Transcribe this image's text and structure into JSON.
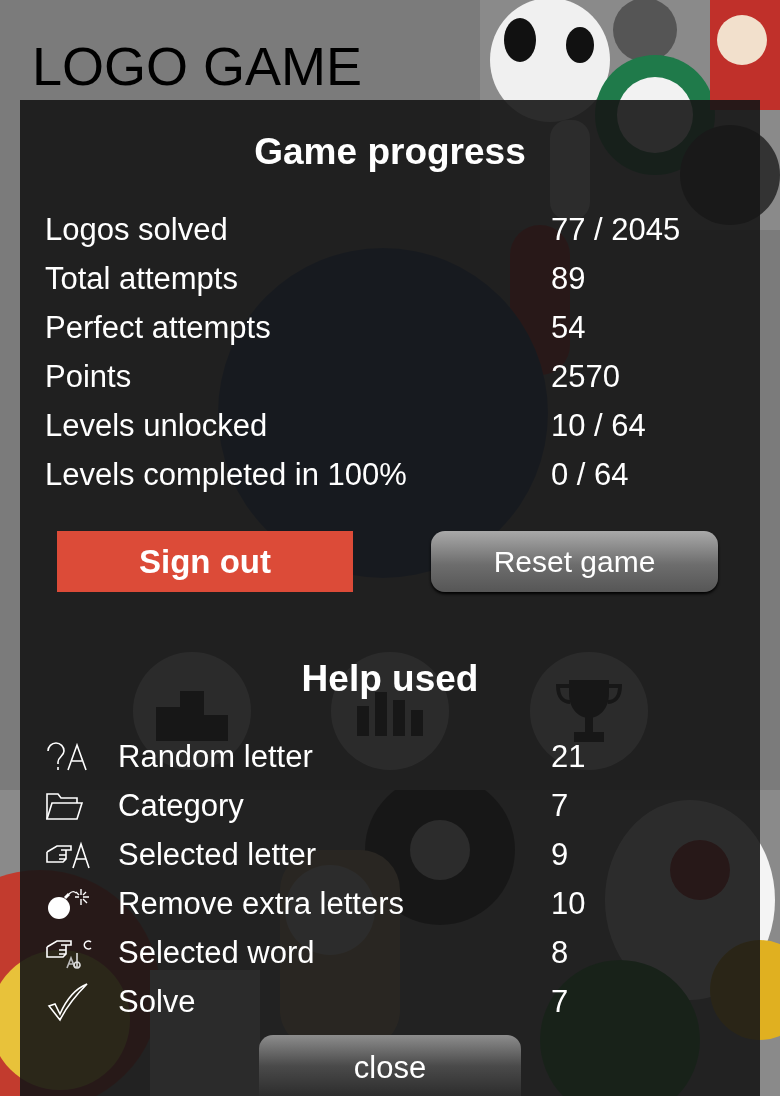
{
  "app": {
    "title": "LOGO GAME"
  },
  "dialog": {
    "title": "Game progress",
    "stats": [
      {
        "label": "Logos solved",
        "value": "77 / 2045"
      },
      {
        "label": "Total attempts",
        "value": "89"
      },
      {
        "label": "Perfect attempts",
        "value": "54"
      },
      {
        "label": "Points",
        "value": "2570"
      },
      {
        "label": "Levels unlocked",
        "value": "10 / 64"
      },
      {
        "label": "Levels completed in 100%",
        "value": "0 / 64"
      }
    ],
    "buttons": [
      {
        "label": "Sign out",
        "kind": "primary"
      },
      {
        "label": "Reset game",
        "kind": "secondary"
      }
    ],
    "help_title": "Help used",
    "help": [
      {
        "kind": "hint",
        "label": "Random letter",
        "count": "21"
      },
      {
        "kind": "folder",
        "label": "Category",
        "count": "7"
      },
      {
        "kind": "pointer",
        "label": "Selected letter",
        "count": "9"
      },
      {
        "kind": "bomb",
        "label": "Remove extra letters",
        "count": "10"
      },
      {
        "kind": "word",
        "label": "Selected word",
        "count": "8"
      },
      {
        "kind": "check",
        "label": "Solve",
        "count": "7"
      }
    ],
    "close": "close"
  }
}
